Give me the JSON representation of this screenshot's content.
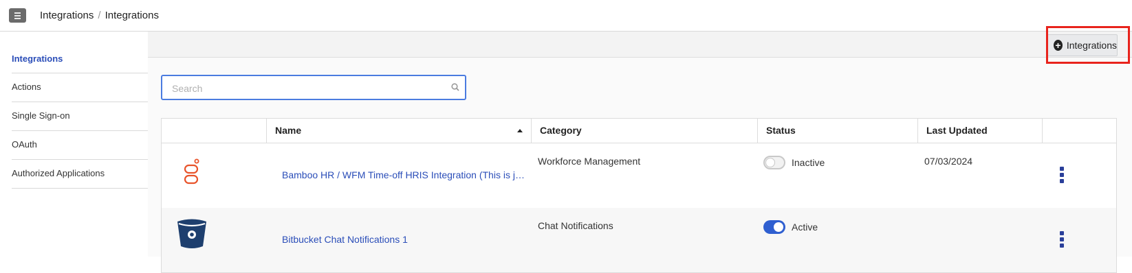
{
  "header": {
    "menu_icon": "hamburger-icon",
    "breadcrumb": [
      "Integrations",
      "Integrations"
    ],
    "separator": "/"
  },
  "sidebar": {
    "items": [
      {
        "label": "Integrations",
        "active": true
      },
      {
        "label": "Actions",
        "active": false
      },
      {
        "label": "Single Sign-on",
        "active": false
      },
      {
        "label": "OAuth",
        "active": false
      },
      {
        "label": "Authorized Applications",
        "active": false
      }
    ]
  },
  "toolbar": {
    "add_label": "Integrations",
    "add_icon": "plus-circle-icon"
  },
  "search": {
    "placeholder": "Search",
    "value": ""
  },
  "table": {
    "columns": [
      "",
      "Name",
      "Category",
      "Status",
      "Last Updated",
      ""
    ],
    "sort_column": "Name",
    "sort_direction": "ascending",
    "rows": [
      {
        "logo": "genesys-logo",
        "name": "Bamboo HR / WFM Time-off HRIS Integration  (This is ju…",
        "category": "Workforce Management",
        "status": "Inactive",
        "active": false,
        "last_updated": "07/03/2024"
      },
      {
        "logo": "bitbucket-logo",
        "name": "Bitbucket Chat Notifications 1",
        "category": "Chat Notifications",
        "status": "Active",
        "active": true,
        "last_updated": ""
      }
    ]
  },
  "colors": {
    "accent": "#2a4db8",
    "highlight": "#e8231c",
    "toggle_on": "#2f5fd0"
  }
}
